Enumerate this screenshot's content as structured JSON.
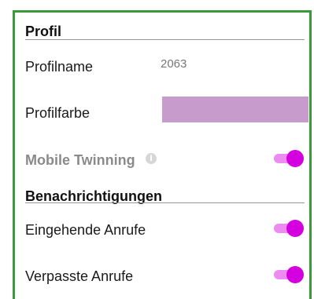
{
  "profile": {
    "header": "Profil",
    "name_label": "Profilname",
    "name_value": "2063",
    "color_label": "Profilfarbe",
    "color_value": "#c79ccd",
    "mobile_twinning_label": "Mobile Twinning",
    "mobile_twinning_info_icon": "info-icon",
    "mobile_twinning_on": true
  },
  "notifications": {
    "header": "Benachrichtigungen",
    "incoming_calls_label": "Eingehende Anrufe",
    "incoming_calls_on": true,
    "missed_calls_label": "Verpasste Anrufe",
    "missed_calls_on": true
  },
  "colors": {
    "accent": "#d500e0",
    "frame": "#3a9a3a"
  }
}
